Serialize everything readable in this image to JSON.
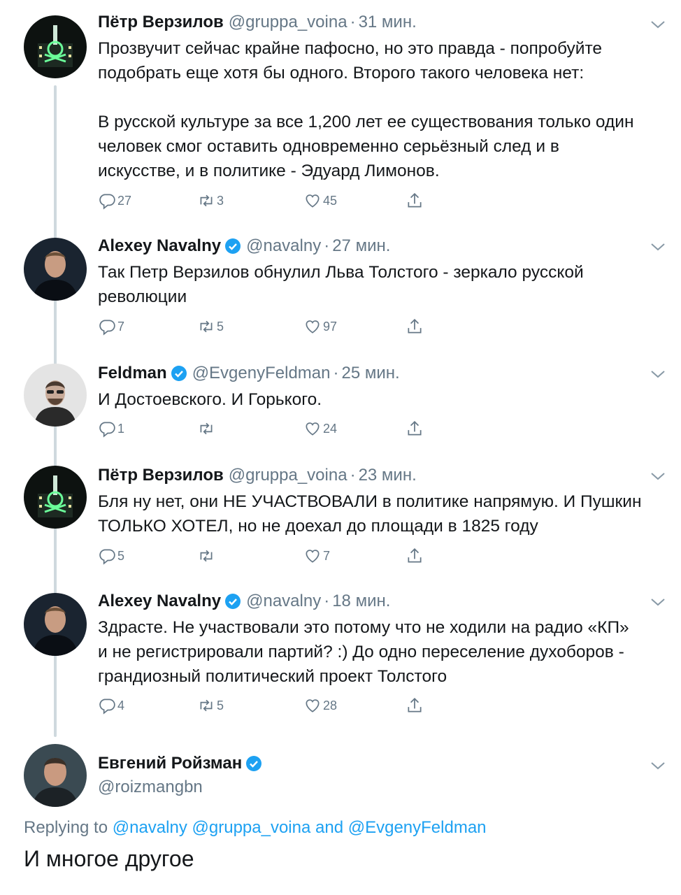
{
  "tweets": [
    {
      "name": "Пётр Верзилов",
      "verified": false,
      "handle": "@gruppa_voina",
      "time": "31 мин.",
      "text": "Прозвучит сейчас крайне пафосно, но это правда - попробуйте\nподобрать еще хотя бы одного. Второго такого человека нет:\n\nВ русской культуре за все 1,200 лет ее существования только один\nчеловек смог оставить одновременно серьёзный след и в\nискусстве, и в политике - Эдуард Лимонов.",
      "replies": "27",
      "retweets": "3",
      "likes": "45",
      "avatar_kind": "verzilov"
    },
    {
      "name": "Alexey Navalny",
      "verified": true,
      "handle": "@navalny",
      "time": "27 мин.",
      "text": "Так Петр Верзилов обнулил Льва Толстого - зеркало русской\nреволюции",
      "replies": "7",
      "retweets": "5",
      "likes": "97",
      "avatar_kind": "navalny"
    },
    {
      "name": "Feldman",
      "verified": true,
      "handle": "@EvgenyFeldman",
      "time": "25 мин.",
      "text": "И Достоевского. И Горького.",
      "replies": "1",
      "retweets": "",
      "likes": "24",
      "avatar_kind": "feldman"
    },
    {
      "name": "Пётр Верзилов",
      "verified": false,
      "handle": "@gruppa_voina",
      "time": "23 мин.",
      "text": "Бля ну нет, они НЕ УЧАСТВОВАЛИ в политике напрямую. И Пушкин\nТОЛЬКО ХОТЕЛ, но не доехал до площади в 1825 году",
      "replies": "5",
      "retweets": "",
      "likes": "7",
      "avatar_kind": "verzilov"
    },
    {
      "name": "Alexey Navalny",
      "verified": true,
      "handle": "@navalny",
      "time": "18 мин.",
      "text": "Здрасте. Не участвовали это потому что не ходили на радио «КП»\nи не регистрировали партий? :) До одно переселение духоборов -\nграндиозный политический проект Толстого",
      "replies": "4",
      "retweets": "5",
      "likes": "28",
      "avatar_kind": "navalny"
    }
  ],
  "last_tweet": {
    "name": "Евгений Ройзман",
    "verified": true,
    "handle": "@roizmangbn",
    "replying_prefix": "Replying to",
    "mention_1": "@navalny",
    "mention_2": "@gruppa_voina",
    "and_word": "and",
    "mention_3": "@EvgenyFeldman",
    "text": "И многое другое"
  },
  "colors": {
    "verified": "#1da1f2",
    "muted": "#657786",
    "thread_line": "#cfd9de",
    "mention": "#1da1f2"
  },
  "icons": [
    "reply-icon",
    "retweet-icon",
    "like-icon",
    "share-icon",
    "chevron-down-icon",
    "verified-badge-icon"
  ]
}
